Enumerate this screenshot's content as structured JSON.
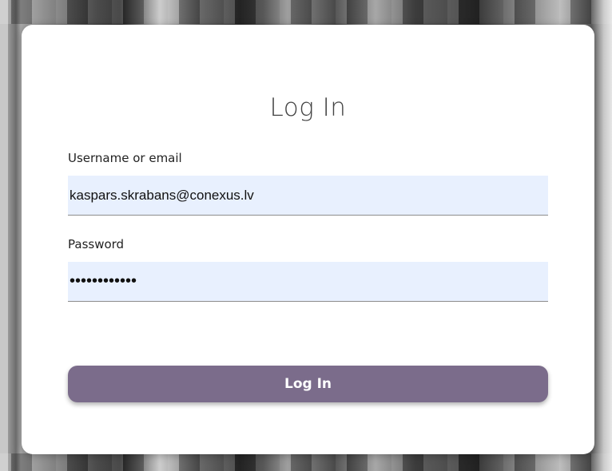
{
  "login": {
    "title": "Log In",
    "username_label": "Username or email",
    "username_value": "kaspars.skrabans@conexus.lv",
    "password_label": "Password",
    "password_value": "••••••••••••",
    "submit_label": "Log In"
  },
  "colors": {
    "input_background": "#e8f0fe",
    "button_background": "#7b6c8b",
    "button_text": "#ffffff"
  }
}
